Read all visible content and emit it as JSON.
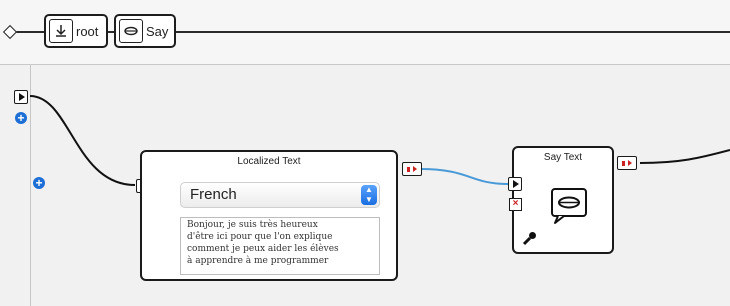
{
  "breadcrumb": {
    "root_label": "root",
    "say_label": "Say",
    "root_icon": "down-arrow-icon",
    "say_icon": "mouth-icon"
  },
  "localized_text_box": {
    "title": "Localized Text",
    "language": "French",
    "text": "Bonjour, je suis très heureux\nd'être ici pour que l'on explique\ncomment je peux aider les élèves\nà apprendre à me programmer"
  },
  "say_text_box": {
    "title": "Say Text",
    "icon": "speech-lips-icon"
  },
  "colors": {
    "wire_link": "#4a9ad8",
    "port_red": "#cc2222",
    "plus_blue": "#1d6fd6"
  }
}
